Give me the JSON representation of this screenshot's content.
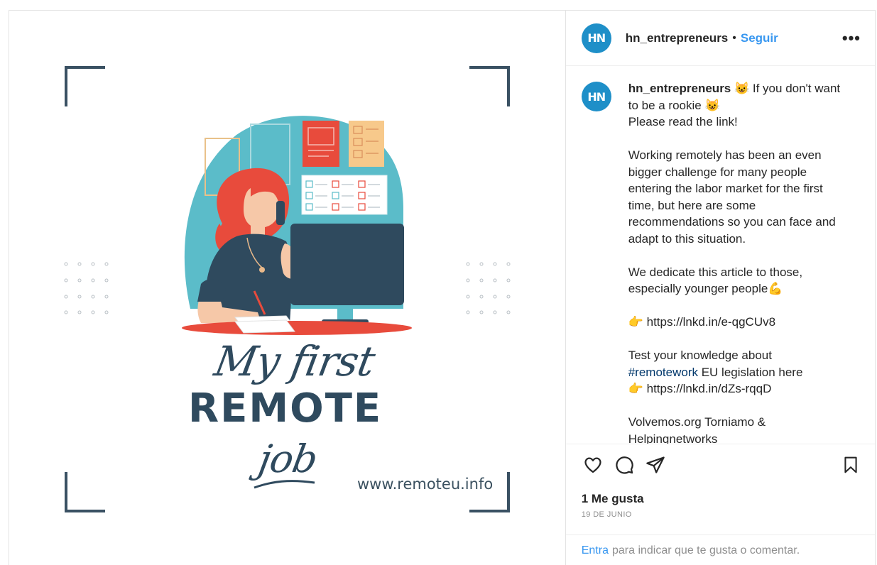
{
  "media": {
    "script_line_1": "My first",
    "big_line": "REMOTE",
    "script_line_2": "job",
    "url": "www.remoteu.info"
  },
  "header": {
    "avatar_text": "HN",
    "username": "hn_entrepreneurs",
    "separator": "•",
    "follow_label": "Seguir",
    "more_label": "•••"
  },
  "caption": {
    "username": "hn_entrepreneurs",
    "lines": {
      "l1": "😺 If you don't want to be a rookie 😺",
      "l2": "Please read the link!",
      "l3": "Working remotely has been an even bigger challenge for many people entering the labor market for the first time, but here are some recommendations so you can face and adapt to this situation.",
      "l4": "We dedicate this article to those, especially younger people💪",
      "l5_emoji": "👉",
      "l5_link": "https://lnkd.in/e-qgCUv8",
      "l6_pre": "Test your knowledge about",
      "l6_hashtag": "#remotework",
      "l6_post": "EU legislation here",
      "l7_emoji": "👉",
      "l7_link": "https://lnkd.in/dZs-rqqD",
      "l8": "Volvemos.org Torniamo & Helpingnetworks"
    }
  },
  "actions": {
    "like_icon": "heart-outline-icon",
    "comment_icon": "comment-bubble-icon",
    "share_icon": "paper-plane-icon",
    "save_icon": "bookmark-icon"
  },
  "likes": {
    "count_label": "1 Me gusta",
    "date": "19 DE JUNIO"
  },
  "login": {
    "link_label": "Entra",
    "text": "para indicar que te gusta o comentar."
  },
  "colors": {
    "accent": "#3897f0",
    "hashtag": "#00376b",
    "avatar": "#1e8fc8",
    "navy": "#2f4a5e",
    "teal": "#5bbcc9",
    "red": "#e84b3c"
  }
}
